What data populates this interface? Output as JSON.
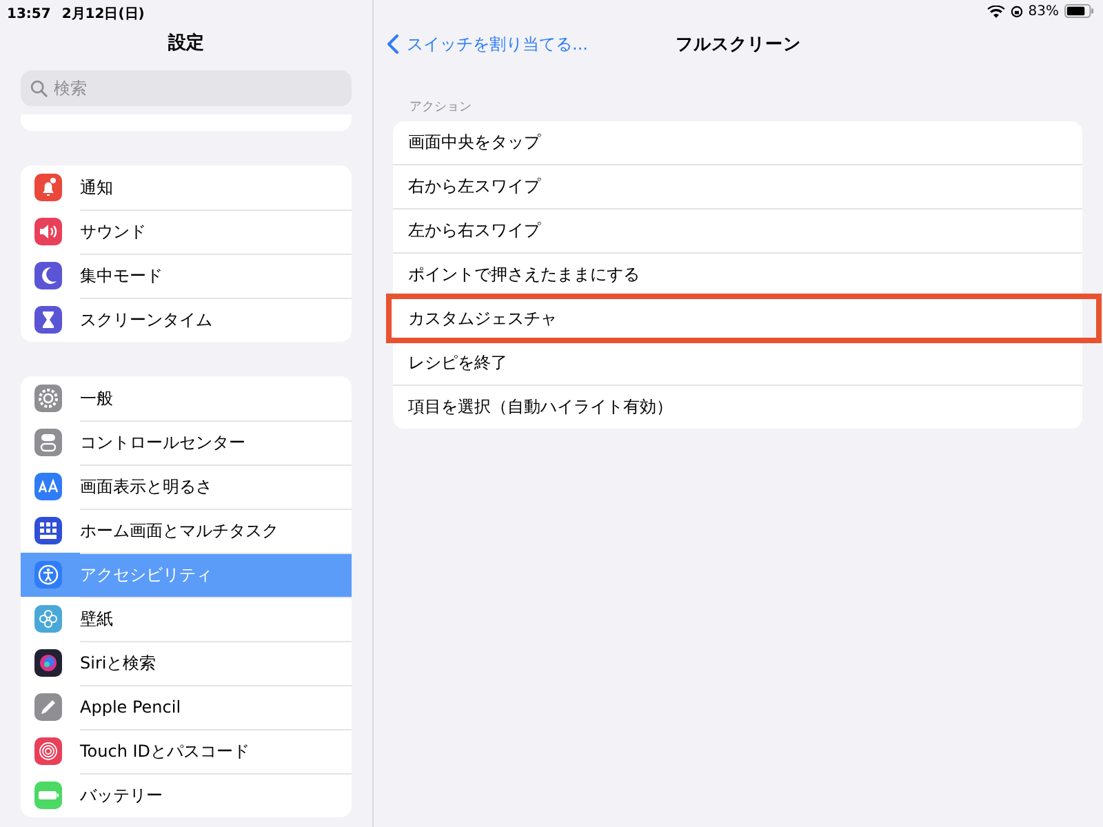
{
  "status_bar": {
    "time": "13:57",
    "date": "2月12日(日)",
    "battery": "83%"
  },
  "sidebar": {
    "title": "設定",
    "search": {
      "placeholder": "検索"
    },
    "groups": [
      {
        "items": [
          {
            "label": "通知",
            "selected": false
          },
          {
            "label": "サウンド",
            "selected": false
          },
          {
            "label": "集中モード",
            "selected": false
          },
          {
            "label": "スクリーンタイム",
            "selected": false
          }
        ]
      },
      {
        "items": [
          {
            "label": "一般",
            "selected": false
          },
          {
            "label": "コントロールセンター",
            "selected": false
          },
          {
            "label": "画面表示と明るさ",
            "selected": false
          },
          {
            "label": "ホーム画面とマルチタスク",
            "selected": false
          },
          {
            "label": "アクセシビリティ",
            "selected": true
          },
          {
            "label": "壁紙",
            "selected": false
          },
          {
            "label": "Siriと検索",
            "selected": false
          },
          {
            "label": "Apple Pencil",
            "selected": false
          },
          {
            "label": "Touch IDとパスコード",
            "selected": false
          },
          {
            "label": "バッテリー",
            "selected": false
          }
        ]
      }
    ]
  },
  "detail": {
    "back": "スイッチを割り当てる...",
    "title": "フルスクリーン",
    "section": "アクション",
    "items": [
      {
        "label": "画面中央をタップ",
        "highlighted": false
      },
      {
        "label": "右から左スワイプ",
        "highlighted": false
      },
      {
        "label": "左から右スワイプ",
        "highlighted": false
      },
      {
        "label": "ポイントで押さえたままにする",
        "highlighted": false
      },
      {
        "label": "カスタムジェスチャ",
        "highlighted": true
      },
      {
        "label": "レシピを終了",
        "highlighted": false
      },
      {
        "label": "項目を選択（自動ハイライト有効）",
        "highlighted": false
      }
    ]
  }
}
